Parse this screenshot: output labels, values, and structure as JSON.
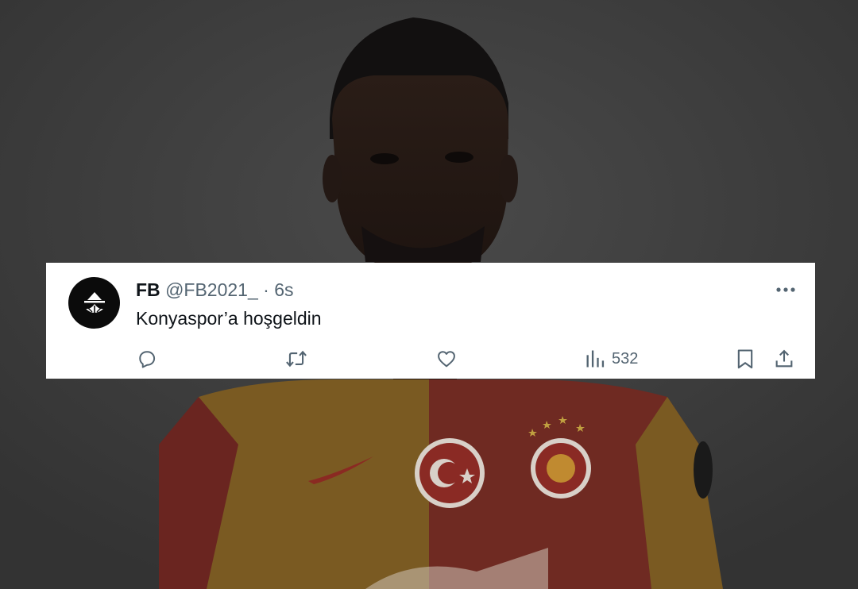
{
  "tweet": {
    "display_name": "FB",
    "handle": "@FB2021_",
    "separator": "·",
    "time": "6s",
    "text": "Konyaspor’a hoşgeldin",
    "views": "532"
  },
  "icons": {
    "avatar": "logo-icon",
    "more": "more-dots-icon",
    "reply": "reply-icon",
    "retweet": "retweet-icon",
    "like": "heart-icon",
    "views": "views-chart-icon",
    "bookmark": "bookmark-icon",
    "share": "share-icon"
  },
  "colors": {
    "card_bg": "#ffffff",
    "text_primary": "#0f1419",
    "text_secondary": "#536471",
    "backdrop": "#3a3a3a",
    "jersey_red": "#a8372c",
    "jersey_yellow": "#c7902b"
  }
}
